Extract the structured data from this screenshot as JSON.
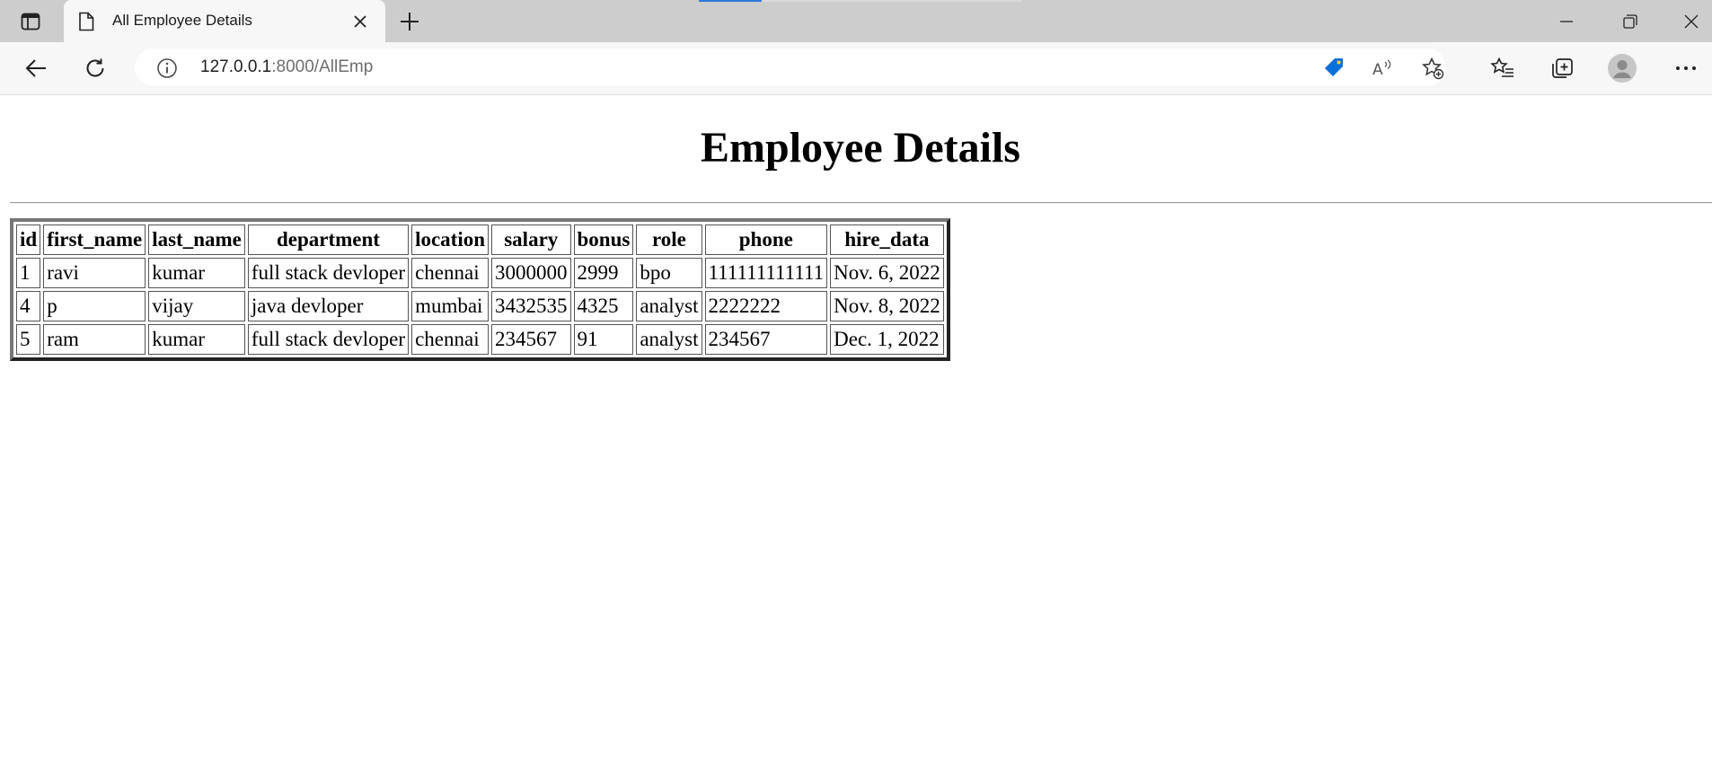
{
  "browser": {
    "tab": {
      "title": "All Employee Details"
    },
    "address": {
      "host": "127.0.0.1",
      "rest": ":8000/AllEmp"
    }
  },
  "page": {
    "title": "Employee Details",
    "table": {
      "headers": [
        "id",
        "first_name",
        "last_name",
        "department",
        "location",
        "salary",
        "bonus",
        "role",
        "phone",
        "hire_data"
      ],
      "rows": [
        [
          "1",
          "ravi",
          "kumar",
          "full stack devloper",
          "chennai",
          "3000000",
          "2999",
          "bpo",
          "111111111111",
          "Nov. 6, 2022"
        ],
        [
          "4",
          "p",
          "vijay",
          "java devloper",
          "mumbai",
          "3432535",
          "4325",
          "analyst",
          "2222222",
          "Nov. 8, 2022"
        ],
        [
          "5",
          "ram",
          "kumar",
          "full stack devloper",
          "chennai",
          "234567",
          "91",
          "analyst",
          "234567",
          "Dec. 1, 2022"
        ]
      ]
    }
  },
  "colors": {
    "accent": "#0a6fd6",
    "chrome_bg": "#cdcdcd",
    "toolbar_bg": "#f7f7f7"
  }
}
